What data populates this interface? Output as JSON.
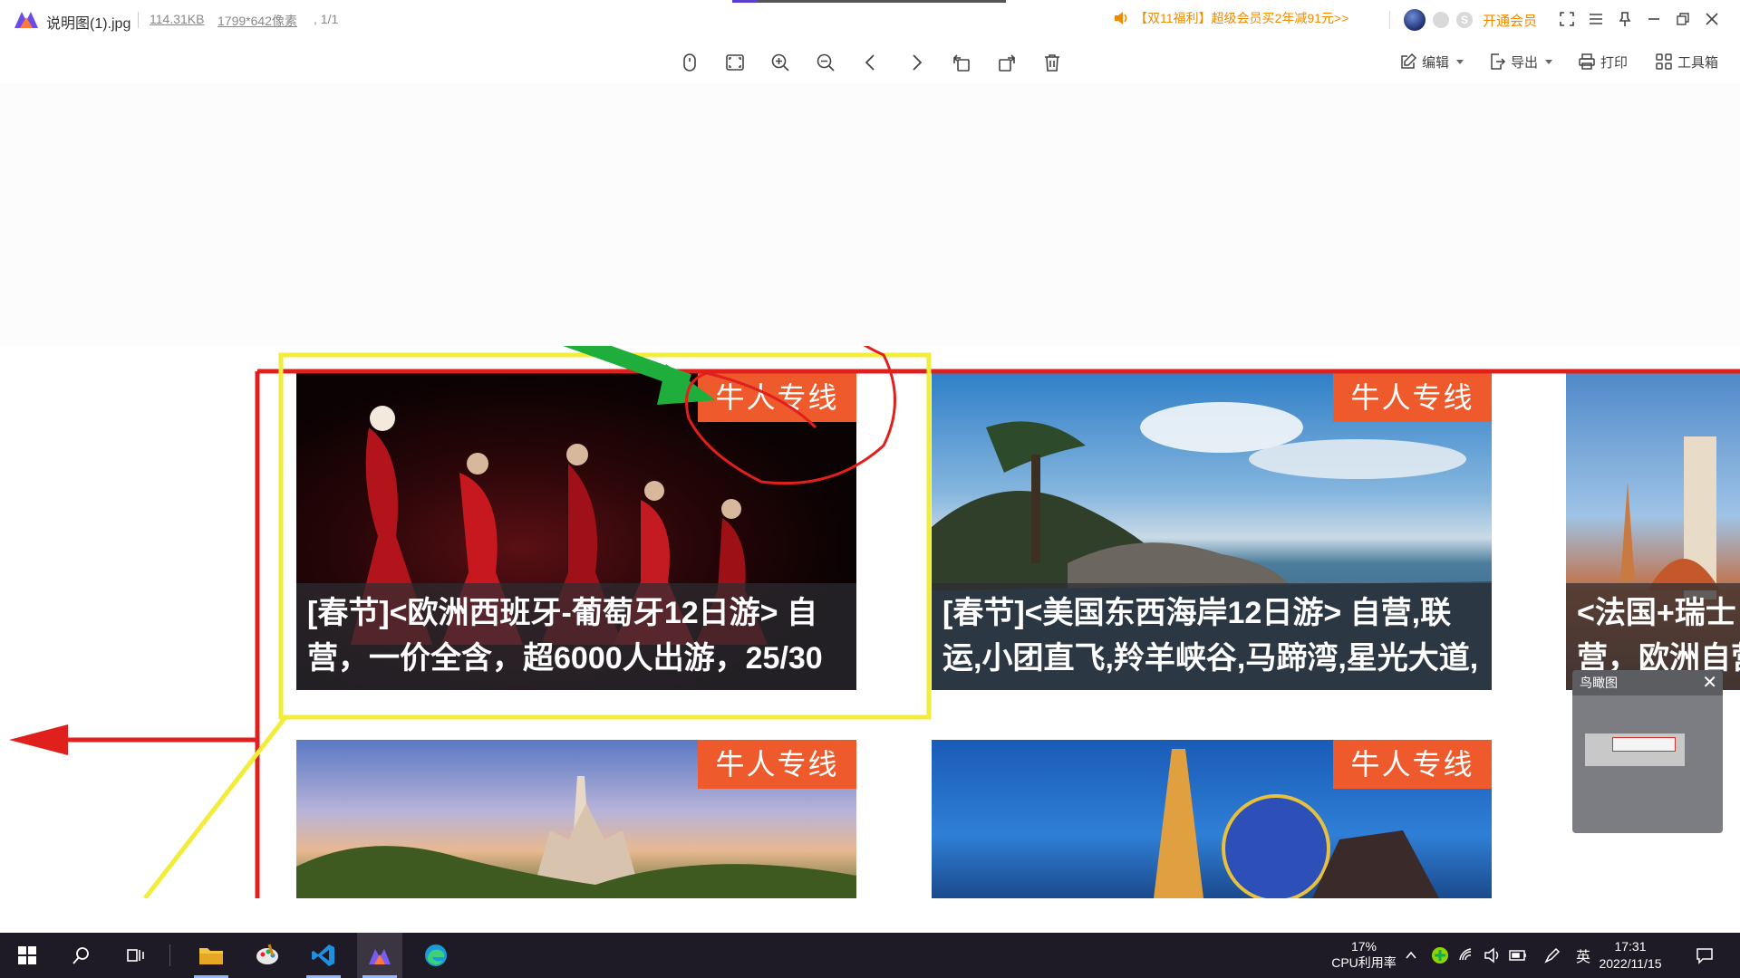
{
  "titlebar": {
    "file_name": "说明图(1).jpg",
    "file_size": "114.31KB",
    "dimensions": "1799*642像素",
    "page_index": ", 1/1",
    "promo": "【双11福利】超级会员买2年减91元>>",
    "vip_label": "开通会员",
    "badge2_glyph": "S"
  },
  "toolbar": {
    "tools": [
      "mouse-mode",
      "fit-window",
      "zoom-in",
      "zoom-out",
      "previous",
      "next",
      "rotate-left",
      "rotate-right",
      "delete"
    ],
    "edit_label": "编辑",
    "export_label": "导出",
    "print_label": "打印",
    "toolbox_label": "工具箱"
  },
  "image": {
    "cards": [
      {
        "tag": "牛人专线",
        "caption_line1": "[春节]<欧洲西班牙-葡萄牙12日游> 自",
        "caption_line2": "营，一价全含，超6000人出游，25/30"
      },
      {
        "tag": "牛人专线",
        "caption_line1": "[春节]<美国东西海岸12日游> 自营,联",
        "caption_line2": "运,小团直飞,羚羊峡谷,马蹄湾,星光大道,"
      },
      {
        "tag": "",
        "caption_line1": "<法国+瑞士",
        "caption_line2": "营，欧洲自营"
      },
      {
        "tag": "牛人专线"
      },
      {
        "tag": "牛人专线"
      }
    ]
  },
  "overview": {
    "title": "鸟瞰图",
    "close": "✕"
  },
  "taskbar": {
    "cpu_percent": "17%",
    "cpu_label": "CPU利用率",
    "ime": "英",
    "time": "17:31",
    "date": "2022/11/15"
  },
  "colors": {
    "accent_orange": "#f08a00",
    "tag_orange": "#ee5a2c",
    "annotation_red": "#e0201c",
    "annotation_yellow": "#f2ec3a",
    "annotation_green": "#1fae3c"
  }
}
